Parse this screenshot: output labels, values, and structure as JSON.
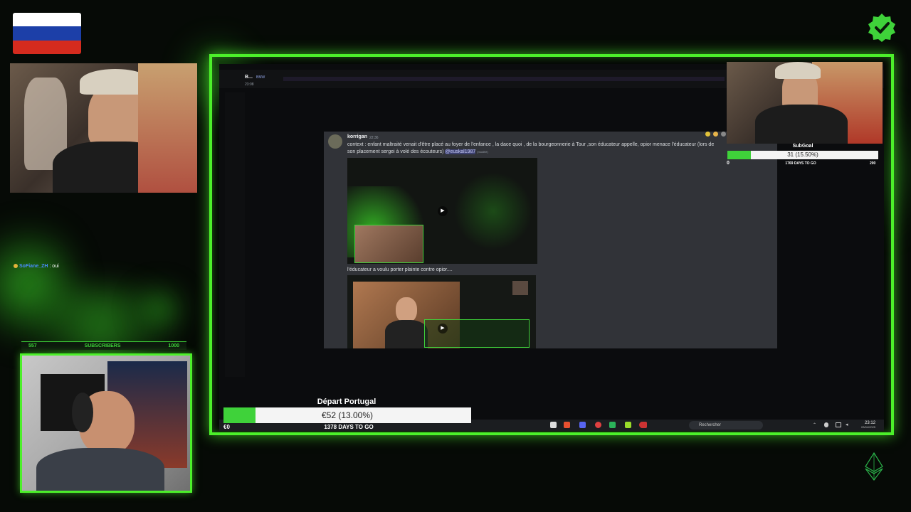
{
  "overlay": {
    "flag": {
      "name": "russia-flag-icon",
      "colors": [
        "#ffffff",
        "#1c3fa8",
        "#d52b1e"
      ]
    },
    "verified_badge": "verified-check-icon",
    "brand_color": "#4cf02a"
  },
  "discord": {
    "top_message": {
      "author": "B...",
      "badge": "BMW",
      "time": "23:08"
    },
    "message": {
      "author": "korrigan",
      "time": "22:36",
      "text": "context : enfant maltraité venait d'être placé au foyer de l'enfance , la dace quoi , de la bourgeonnerie à Tour ,son éducateur appelle, opior menace l'éducateur (lors de son placement sergei à volé des écouteurs)",
      "mention": "@euskal1987",
      "edited": "(modifié)",
      "second_text": "l'éducateur a voulu porter plainte contre opior...."
    }
  },
  "taskbar": {
    "search_placeholder": "Rechercher",
    "time": "23:12",
    "date": "03/04/2025"
  },
  "subgoal": {
    "title": "SubGoal",
    "progress_label": "31 (15.50%)",
    "progress": 0.155,
    "min": "0",
    "days": "1769 DAYS TO GO",
    "max": "200"
  },
  "depart_goal": {
    "title": "Départ Portugal",
    "progress_label": "€52 (13.00%)",
    "progress": 0.13,
    "min": "€0",
    "days": "1378 DAYS TO GO"
  },
  "subscribers": {
    "current": "557",
    "label": "SUBSCRIBERS",
    "target": "1000"
  },
  "chat": {
    "user": "SoFiane_ZH",
    "message": ": oui"
  }
}
